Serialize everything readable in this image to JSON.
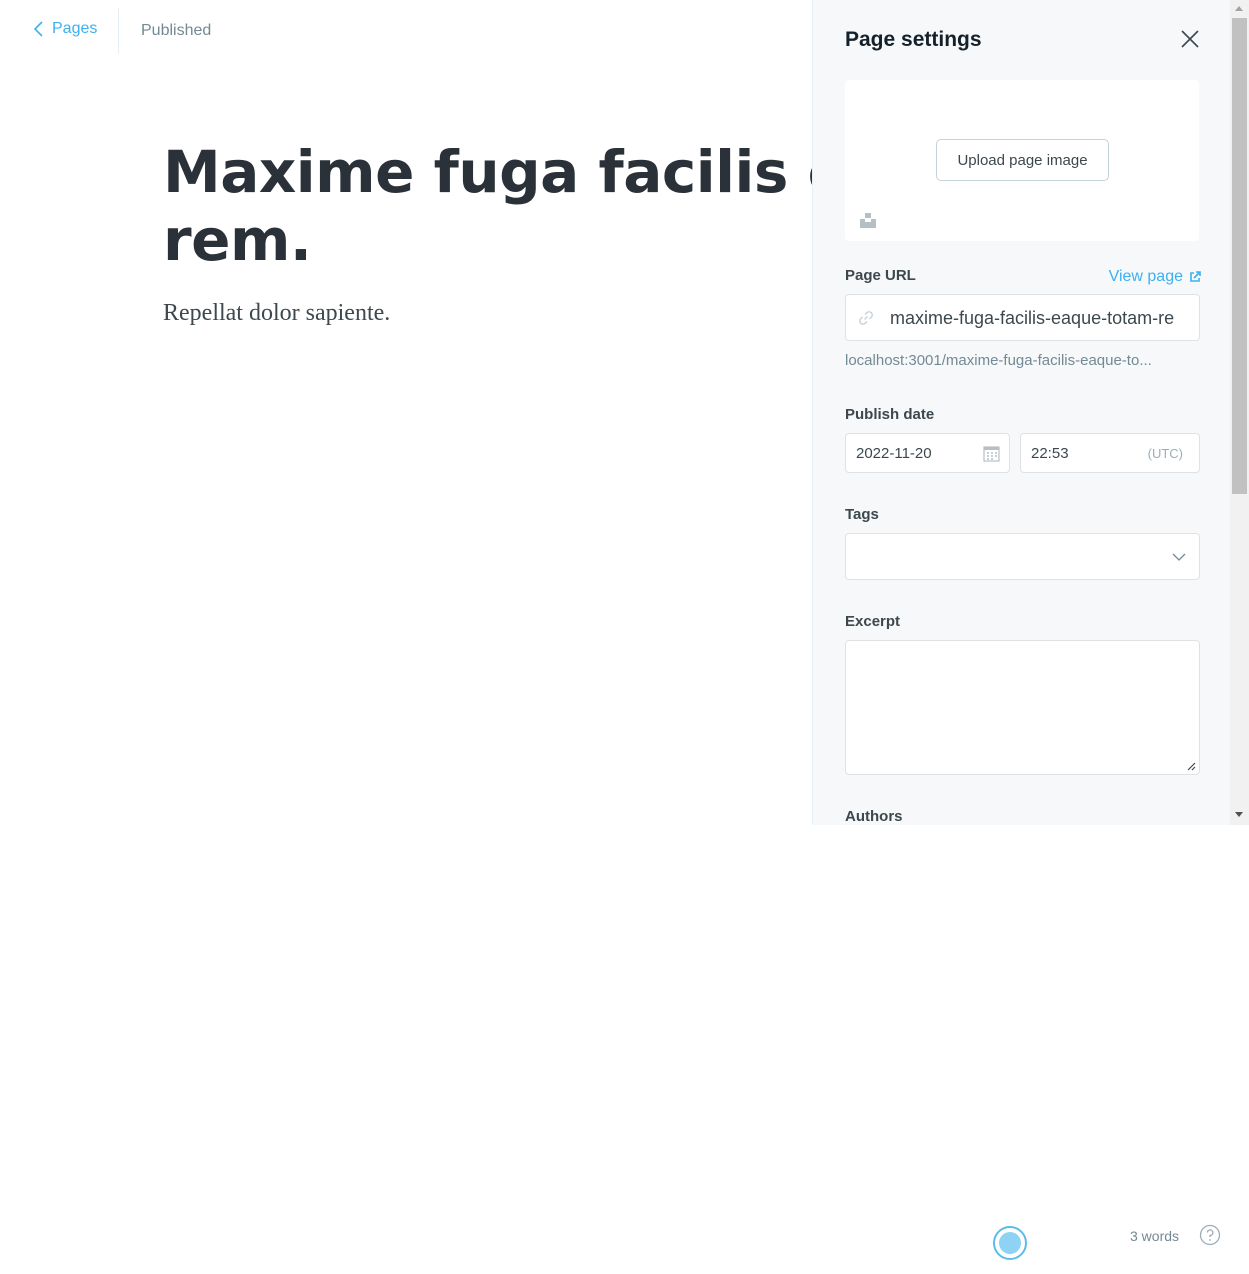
{
  "topbar": {
    "back_label": "Pages",
    "status": "Published"
  },
  "editor": {
    "title_line1": "Maxime fuga facilis eaqu",
    "title_line2": "rem.",
    "body": "Repellat dolor sapiente."
  },
  "settings": {
    "title": "Page settings",
    "upload_label": "Upload page image",
    "url_label": "Page URL",
    "view_page_label": "View page",
    "url_value": "maxime-fuga-facilis-eaque-totam-re",
    "url_hint": "localhost:3001/maxime-fuga-facilis-eaque-to...",
    "publish_date_label": "Publish date",
    "date_value": "2022-11-20",
    "time_value": "22:53",
    "timezone": "(UTC)",
    "tags_label": "Tags",
    "excerpt_label": "Excerpt",
    "authors_label": "Authors"
  },
  "footer": {
    "word_count": "3 words"
  },
  "colors": {
    "accent": "#3eb0ef",
    "panel_bg": "#f6f8fa",
    "title_text": "#2a3138"
  }
}
